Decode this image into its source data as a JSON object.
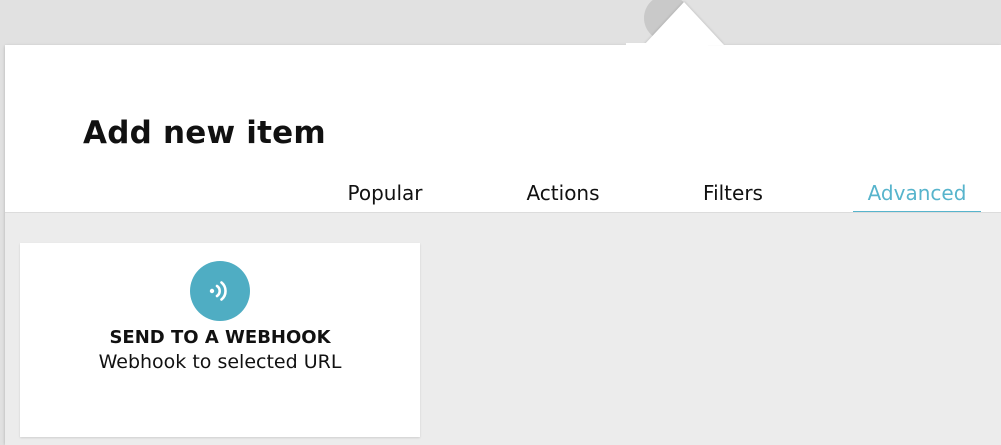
{
  "dialog": {
    "title": "Add new item"
  },
  "tabs": [
    {
      "label": "Popular",
      "active": false
    },
    {
      "label": "Actions",
      "active": false
    },
    {
      "label": "Filters",
      "active": false
    },
    {
      "label": "Advanced",
      "active": true
    }
  ],
  "items": [
    {
      "title": "SEND TO A WEBHOOK",
      "description": "Webhook to selected URL",
      "icon": "webhook-signal-icon"
    }
  ],
  "colors": {
    "accent": "#57b4cc",
    "icon_bg": "#4fadc3",
    "content_bg": "#ececec",
    "page_bg": "#e1e1e1"
  }
}
